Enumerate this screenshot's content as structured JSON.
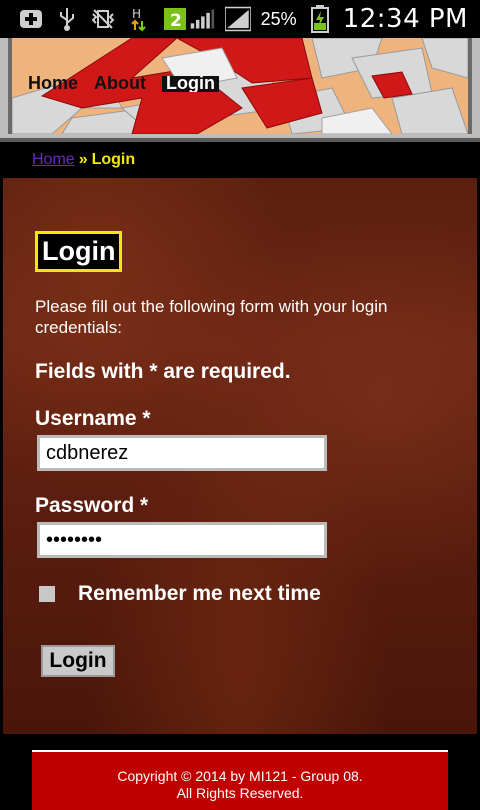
{
  "status_bar": {
    "battery_percent": "25%",
    "time": "12:34 PM",
    "notification_count": "2",
    "network_type": "H",
    "icons": [
      "add-icon",
      "usb-icon",
      "vibrate-icon",
      "network-h-icon",
      "notification-badge-icon",
      "signal-icon",
      "signal-2-icon",
      "battery-charging-icon"
    ]
  },
  "nav": {
    "items": [
      {
        "label": "Home",
        "active": false
      },
      {
        "label": "About",
        "active": false
      },
      {
        "label": "Login",
        "active": true
      }
    ]
  },
  "breadcrumb": {
    "home": "Home",
    "separator": "»",
    "current": "Login"
  },
  "page": {
    "title": "Login",
    "intro": "Please fill out the following form with your login credentials:",
    "required_note": "Fields with * are required."
  },
  "form": {
    "username_label": "Username *",
    "username_value": "cdbnerez",
    "password_label": "Password *",
    "password_value": "••••••••",
    "remember_label": "Remember me next time",
    "remember_checked": false,
    "submit_label": "Login"
  },
  "footer": {
    "line1": "Copyright © 2014 by MI121 - Group 08.",
    "line2": "All Rights Reserved."
  },
  "colors": {
    "accent_yellow": "#f5e800",
    "footer_red": "#c00000",
    "background_brown": "#5b1f10"
  }
}
